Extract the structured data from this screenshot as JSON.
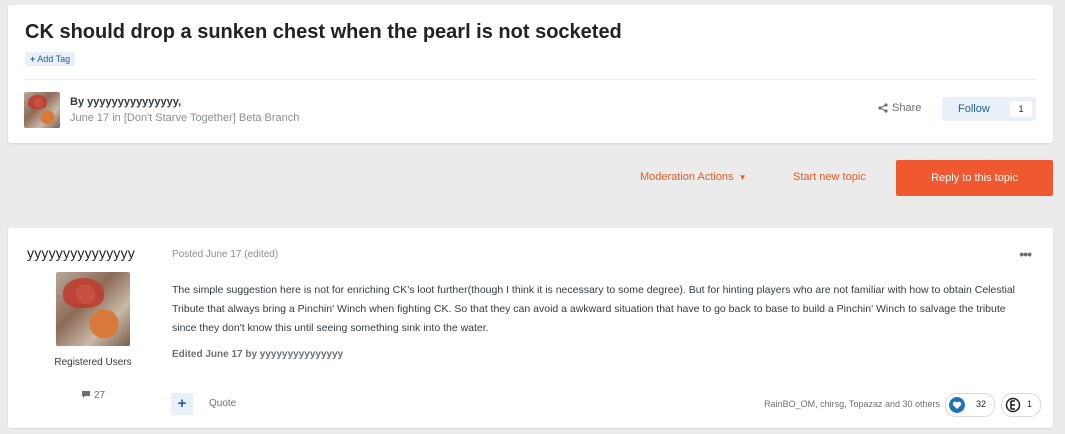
{
  "topic": {
    "title": "CK should drop a sunken chest when the pearl is not socketed",
    "add_tag": "Add Tag",
    "by_label": "By",
    "author": "yyyyyyyyyyyyyyy,",
    "date": "June 17",
    "in_label": "in",
    "forum": "[Don't Starve Together] Beta Branch",
    "share_label": "Share",
    "follow_label": "Follow",
    "follow_count": "1"
  },
  "actions": {
    "moderation": "Moderation Actions",
    "start_new_topic": "Start new topic",
    "reply": "Reply to this topic"
  },
  "post": {
    "author": "yyyyyyyyyyyyyyy",
    "group": "Registered Users",
    "post_count": "27",
    "posted": "Posted June 17 (edited)",
    "body": "The simple suggestion here is not for enriching CK's loot further(though I think it is necessary to some degree). But for hinting players who are not familiar with how to obtain Celestial Tribute that always bring a Pinchin' Winch when fighting CK. So that they can avoid a awkward situation that have to go back to base to build a Pinchin' Winch to salvage the tribute since they don't know this until seeing something sink into the water.",
    "edited": "Edited June 17 by yyyyyyyyyyyyyyy",
    "quote_label": "Quote",
    "reactors": "RainBO_OM, chirsg, Topazaz and 30 others",
    "reactions": [
      {
        "icon": "heart-reaction-icon",
        "count": "32",
        "color": "#1d72b8"
      },
      {
        "icon": "coin-reaction-icon",
        "count": "1",
        "color": "#222222"
      }
    ]
  },
  "colors": {
    "accent": "#f0582f",
    "link_orange": "#e05d2c",
    "follow_blue": "#26609c",
    "background": "#ebebeb"
  }
}
